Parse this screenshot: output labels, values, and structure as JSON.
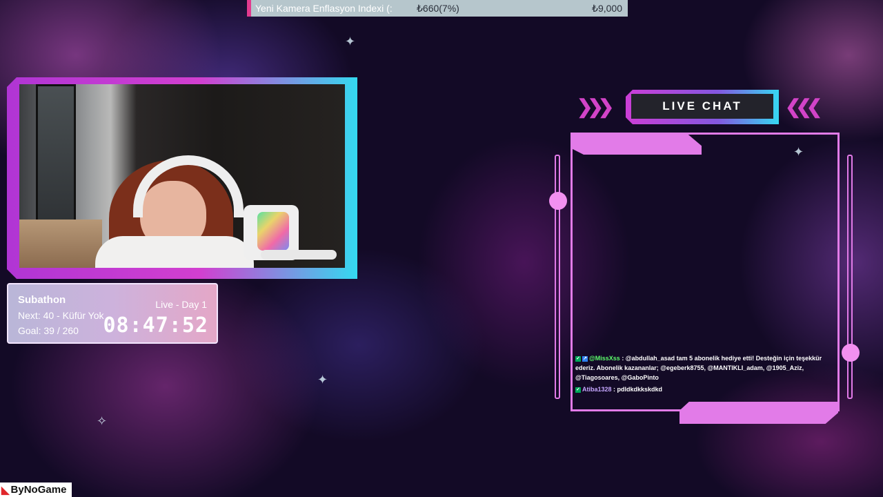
{
  "ticker": {
    "label": "Yeni Kamera Enflasyon Indexi (:",
    "change": "₺660(7%)",
    "total": "₺9,000"
  },
  "subathon": {
    "title": "Subathon",
    "next": "Next: 40 - Küfür Yok",
    "goal": "Goal: 39 / 260",
    "live": "Live - Day 1",
    "timer": "08:47:52"
  },
  "chat": {
    "title": "LIVE CHAT",
    "messages": [
      {
        "user": "@MissXss",
        "text": " : @abdullah_asad tam 5 abonelik hediye etti! Desteğin için teşekkür ederiz. Abonelik kazananlar; @egeberk8755, @MANTIKLI_adam, @1905_Aziz, @Tiagosoares, @GaboPinto"
      },
      {
        "user": "Atiba1328",
        "text": " : pdldkdkkskdkd"
      }
    ]
  },
  "watermark": {
    "text": "ByNoGame"
  },
  "colors": {
    "accent_pink": "#e27be8",
    "accent_cyan": "#36d7f2",
    "ticker_bg": "#b6c6cc"
  }
}
